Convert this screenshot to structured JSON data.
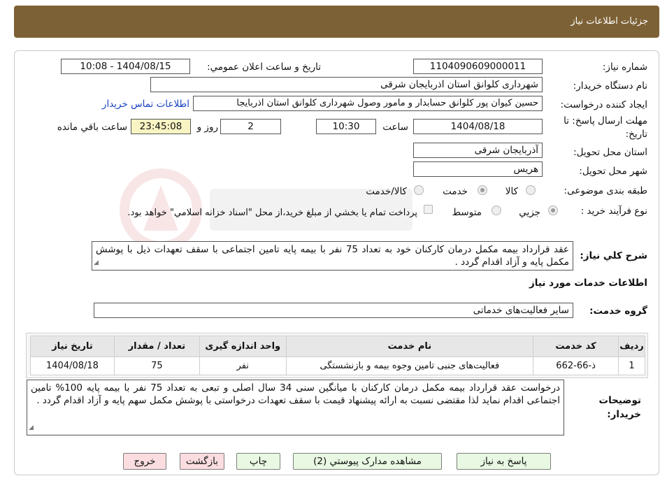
{
  "header": {
    "title": "جزئیات اطلاعات نیاز"
  },
  "need_number": {
    "label": "شماره نیاز:",
    "value": "1104090609000011"
  },
  "announce": {
    "label": "تاریخ و ساعت اعلان عمومي:",
    "value": "1404/08/15 - 10:08"
  },
  "buyer_org": {
    "label": "نام دستگاه خريدار:",
    "value": "شهرداری کلوانق استان اذربایجان شرقی"
  },
  "requester": {
    "label": "ايجاد کننده درخواست:",
    "value": "حسین  کیوان پور کلوانق حسابدار و مامور وصول شهرداری کلوانق استان اذربایجا",
    "contact_link": "اطلاعات تماس خريدار"
  },
  "deadline": {
    "label_line1": "مهلت ارسال پاسخ: تا",
    "label_line2": "تاریخ:",
    "date": "1404/08/18",
    "time_label": "ساعت",
    "time": "10:30",
    "days": "2",
    "days_label": "روز و",
    "remaining": "23:45:08",
    "remaining_label": "ساعت باقي مانده"
  },
  "province": {
    "label": "استان محل تحويل:",
    "value": "آذربایجان شرقی"
  },
  "city": {
    "label": "شهر محل تحويل:",
    "value": "هریس"
  },
  "category": {
    "label": "طبقه بندی موضوعی:",
    "options": [
      "کالا",
      "خدمت",
      "کالا/خدمت"
    ],
    "selected": "خدمت"
  },
  "purchase_process": {
    "label": "نوع فرآيند خريد :",
    "options": [
      "جزيي",
      "متوسط"
    ],
    "selected": "جزيي",
    "payment_note": "پرداخت تمام يا بخشي از مبلغ خريد،از محل \"اسناد خزانه اسلامي\" خواهد بود."
  },
  "general_description": {
    "label": "شرح كلي نياز:",
    "value": "عقد قرارداد بیمه مکمل درمان کارکنان خود   به تعداد 75 نفر با بیمه پایه تامین اجتماعی   با سقف تعهدات ذیل با پوشش مکمل پایه و آزاد اقدام گردد ."
  },
  "services_section": {
    "title": "اطلاعات خدمات مورد نياز"
  },
  "service_group": {
    "label": "گروه خدمت:",
    "value": "ساير فعاليت‌هاى خدماتى"
  },
  "services_table": {
    "headers": [
      "رديف",
      "کد خدمت",
      "نام خدمت",
      "واحد اندازه گيری",
      "تعداد / مقدار",
      "تاريخ نياز"
    ],
    "rows": [
      [
        "1",
        "ذ-66-662",
        "فعالیت‌های جنبی تامین وجوه بیمه و بازنشستگی",
        "نفر",
        "75",
        "1404/08/18"
      ]
    ]
  },
  "buyer_notes": {
    "label_line1": "توضيحات",
    "label_line2": "خريدار:",
    "value": "درخواست عقد قرارداد بیمه مکمل درمان کارکنان با میانگین سنی 34 سال اصلی و تبعی  به تعداد 75 نفر با بیمه پایه 100% تامین اجتماعی  اقدام نماید لذا مقتضی نسبت  به ارائه پیشنهاد قیمت با سقف تعهدات درخواستی با پوشش مکمل سهم پایه و آزاد اقدام گردد ."
  },
  "buttons": {
    "respond": "پاسخ به نياز",
    "attachments": "مشاهده مدارک پيوستي (2)",
    "print": "چاپ",
    "back": "بازگشت",
    "exit": "خروج"
  },
  "colors": {
    "header": "#7d6136",
    "remaining_bg": "#f9f4c3",
    "link": "#1a44c4",
    "green_btn": "#e8f8e2",
    "pink_btn": "#fbdde0"
  }
}
